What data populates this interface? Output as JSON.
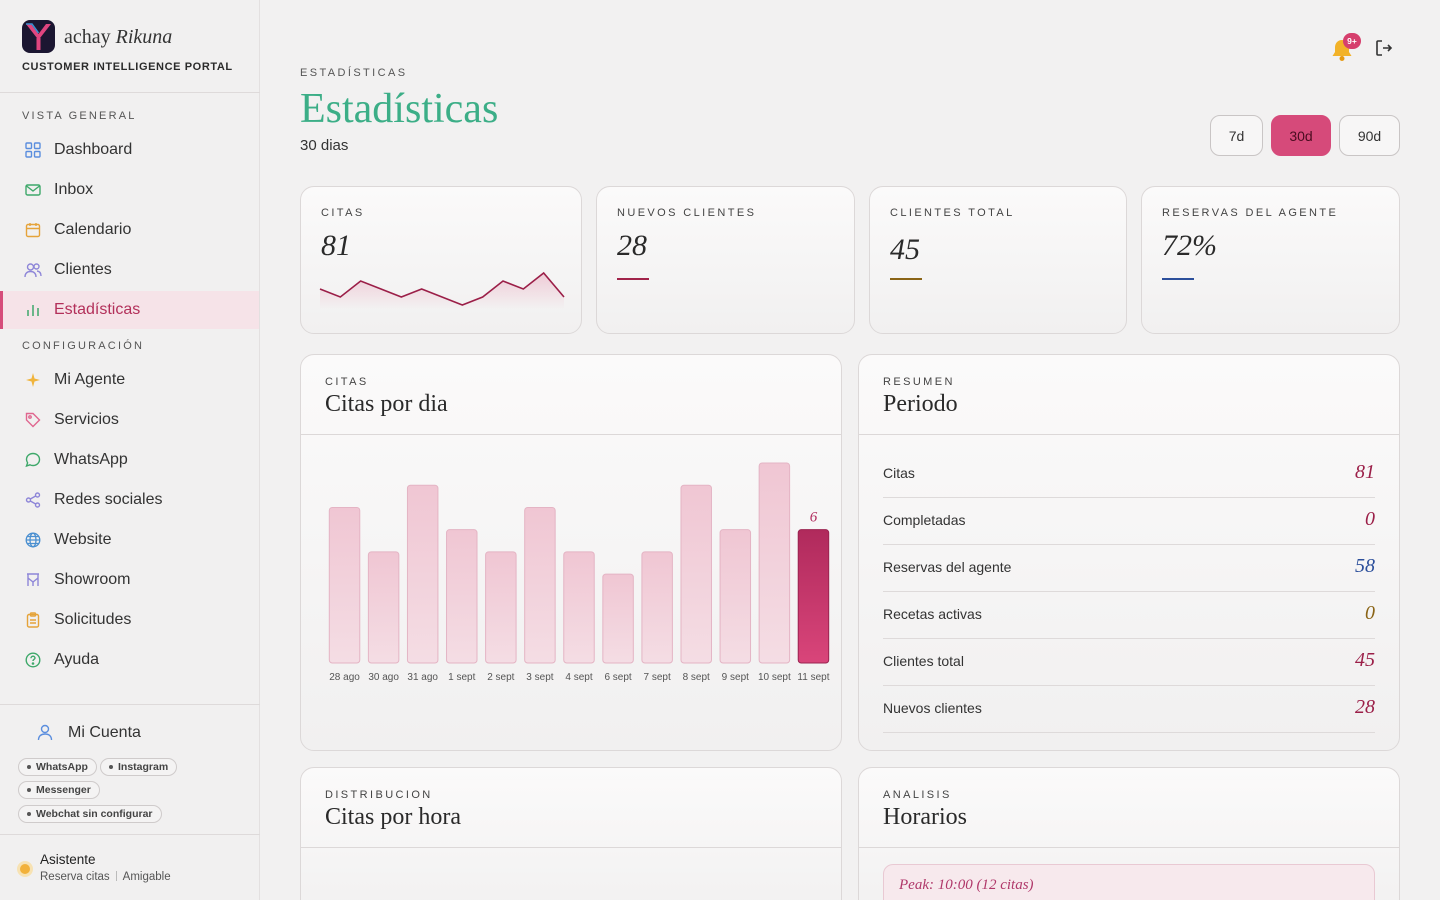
{
  "brand": {
    "name_plain": "achay",
    "name_accent": "Rikuna",
    "tagline": "CUSTOMER INTELLIGENCE PORTAL"
  },
  "sidebar": {
    "section_overview": "VISTA GENERAL",
    "section_config": "CONFIGURACIÓN",
    "items": [
      {
        "label": "Dashboard",
        "icon": "grid-icon"
      },
      {
        "label": "Inbox",
        "icon": "mail-icon"
      },
      {
        "label": "Calendario",
        "icon": "calendar-icon"
      },
      {
        "label": "Clientes",
        "icon": "users-icon"
      },
      {
        "label": "Estadísticas",
        "icon": "bar-chart-icon",
        "active": true
      },
      {
        "label": "Mi Agente",
        "icon": "sparkle-icon"
      },
      {
        "label": "Servicios",
        "icon": "tag-icon"
      },
      {
        "label": "WhatsApp",
        "icon": "chat-icon"
      },
      {
        "label": "Redes sociales",
        "icon": "share-icon"
      },
      {
        "label": "Website",
        "icon": "globe-icon"
      },
      {
        "label": "Showroom",
        "icon": "showroom-icon"
      },
      {
        "label": "Solicitudes",
        "icon": "clipboard-icon"
      },
      {
        "label": "Ayuda",
        "icon": "help-icon"
      }
    ],
    "account_label": "Mi Cuenta",
    "channels": [
      "WhatsApp",
      "Instagram",
      "Messenger",
      "Webchat sin configurar"
    ],
    "assistant": {
      "name": "Asistente",
      "mode": "Reserva citas",
      "tone": "Amigable"
    }
  },
  "header": {
    "eyebrow": "ESTADÍSTICAS",
    "title": "Estadísticas",
    "subtitle": "30 dias",
    "notification_badge": "9+",
    "ranges": [
      "7d",
      "30d",
      "90d"
    ],
    "active_range": "30d"
  },
  "kpis": [
    {
      "label": "CITAS",
      "value": "81",
      "accent": "#9b1f48"
    },
    {
      "label": "NUEVOS CLIENTES",
      "value": "28",
      "accent": "#a1234a"
    },
    {
      "label": "CLIENTES TOTAL",
      "value": "45",
      "accent": "#8a6416"
    },
    {
      "label": "RESERVAS DEL AGENTE",
      "value": "72%",
      "accent": "#2c4f9b"
    }
  ],
  "sparkline": [
    3,
    2,
    4,
    3,
    2,
    3,
    2,
    1,
    2,
    4,
    3,
    5,
    2
  ],
  "bar_panel": {
    "eyebrow": "CITAS",
    "title": "Citas por dia",
    "chart_data": {
      "type": "bar",
      "categories": [
        "28 ago",
        "30 ago",
        "31 ago",
        "1 sept",
        "2 sept",
        "3 sept",
        "4 sept",
        "6 sept",
        "7 sept",
        "8 sept",
        "9 sept",
        "10 sept",
        "11 sept"
      ],
      "values": [
        7,
        5,
        8,
        6,
        5,
        7,
        5,
        4,
        5,
        8,
        6,
        9,
        6
      ],
      "highlight_index": 12,
      "highlight_label": "6",
      "colors": {
        "bar": "#f0c6d3",
        "highlight": "#b02a5c"
      }
    }
  },
  "summary_panel": {
    "eyebrow": "RESUMEN",
    "title": "Periodo",
    "rows": [
      {
        "label": "Citas",
        "value": "81",
        "color": "#9b1f48"
      },
      {
        "label": "Completadas",
        "value": "0",
        "color": "#9b1f48"
      },
      {
        "label": "Reservas del agente",
        "value": "58",
        "color": "#2c4f9b"
      },
      {
        "label": "Recetas activas",
        "value": "0",
        "color": "#8a6416"
      },
      {
        "label": "Clientes total",
        "value": "45",
        "color": "#9b1f48"
      },
      {
        "label": "Nuevos clientes",
        "value": "28",
        "color": "#9b1f48"
      }
    ]
  },
  "hour_panel": {
    "eyebrow": "DISTRIBUCION",
    "title": "Citas por hora"
  },
  "analysis_panel": {
    "eyebrow": "ANALISIS",
    "title": "Horarios",
    "peak": "Peak: 10:00 (12 citas)"
  }
}
